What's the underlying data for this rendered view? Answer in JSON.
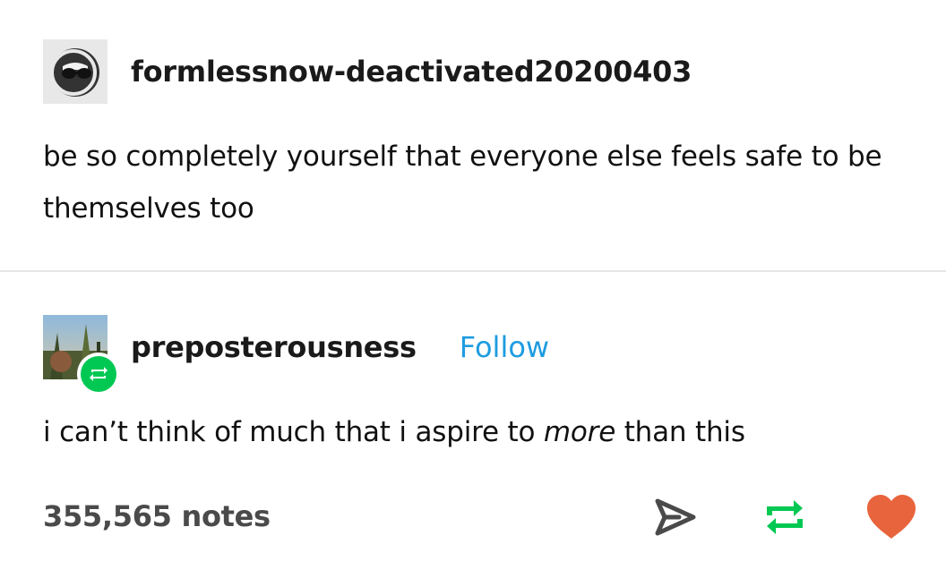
{
  "post": {
    "author": {
      "username": "formlessnow-deactivated20200403",
      "avatar_icon": "sunglasses-face-icon"
    },
    "text": "be so completely yourself that everyone else feels safe to be themselves too"
  },
  "reblog": {
    "author": {
      "username": "preposterousness",
      "follow_label": "Follow",
      "avatar_icon": "photo-avatar",
      "badge_icon": "reblog-icon"
    },
    "text_before": "i can’t think of much that i aspire to ",
    "text_emphasis": "more",
    "text_after": " than this"
  },
  "footer": {
    "notes": "355,565 notes",
    "share_icon": "send-icon",
    "reblog_icon": "reblog-icon",
    "like_icon": "heart-icon"
  },
  "colors": {
    "follow": "#1e9ce0",
    "reblog": "#00c853",
    "heart": "#e8643c",
    "notes": "#4a4a4a"
  }
}
